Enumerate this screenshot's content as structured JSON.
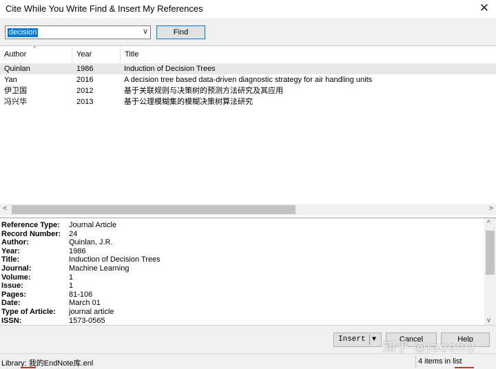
{
  "window": {
    "title": "Cite While You Write Find & Insert My References",
    "close_glyph": "✕"
  },
  "search": {
    "value": "decision",
    "dropdown_glyph": "∨",
    "find_label": "Find"
  },
  "list": {
    "columns": [
      "Author",
      "Year",
      "Title"
    ],
    "sort_glyph": "^",
    "rows": [
      {
        "author": "Quinlan",
        "year": "1986",
        "title": "Induction of Decision Trees"
      },
      {
        "author": "Yan",
        "year": "2016",
        "title": "A decision tree based data-driven diagnostic strategy for air handling units"
      },
      {
        "author": "伊卫国",
        "year": "2012",
        "title": "基于关联规则与决策树的预测方法研究及其应用"
      },
      {
        "author": "冯兴华",
        "year": "2013",
        "title": "基于公理模糊集的模糊决策树算法研究"
      }
    ]
  },
  "scroll": {
    "left_glyph": "<",
    "right_glyph": ">",
    "up_glyph": "^",
    "down_glyph": "v"
  },
  "detail": {
    "fields": [
      {
        "label": "Reference Type:",
        "value": "Journal Article"
      },
      {
        "label": "Record Number:",
        "value": "24"
      },
      {
        "label": "Author:",
        "value": "Quinlan, J.R."
      },
      {
        "label": "Year:",
        "value": "1986"
      },
      {
        "label": "Title:",
        "value": "Induction of Decision Trees"
      },
      {
        "label": "Journal:",
        "value": "Machine Learning"
      },
      {
        "label": "Volume:",
        "value": "1"
      },
      {
        "label": "Issue:",
        "value": "1"
      },
      {
        "label": "Pages:",
        "value": "81-106"
      },
      {
        "label": "Date:",
        "value": "March 01"
      },
      {
        "label": "Type of Article:",
        "value": "journal article"
      },
      {
        "label": "ISSN:",
        "value": "1573-0565"
      }
    ]
  },
  "buttons": {
    "insert": "Insert",
    "insert_drop": "▼",
    "cancel": "Cancel",
    "help": "Help"
  },
  "status": {
    "library": "Library: 我的EndNote库.enl",
    "count": "4 items in list"
  },
  "watermark": "知乎 @JadenQ"
}
